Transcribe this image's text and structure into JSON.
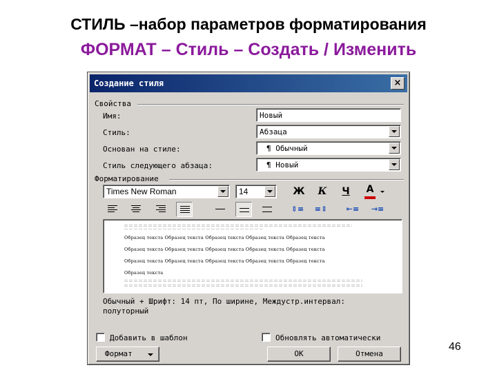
{
  "slide": {
    "title": "СТИЛЬ –набор параметров форматирования",
    "subtitle": "ФОРМАТ – Стиль – Создать / Изменить",
    "page_number": "46"
  },
  "dialog": {
    "title": "Создание стиля",
    "close_label": "×",
    "properties_group": "Свойства",
    "name_label": "Имя:",
    "name_value": "Новый",
    "style_label": "Стиль:",
    "style_value": "Абзаца",
    "based_on_label": "Основан на стиле:",
    "based_on_value": "¶ Обычный",
    "next_style_label": "Стиль следующего абзаца:",
    "next_style_value": "¶ Новый",
    "formatting_group": "Форматирование",
    "font_name": "Times New Roman",
    "font_size": "14",
    "bold_label": "Ж",
    "italic_label": "К",
    "underline_label": "Ч",
    "font_color_label": "А",
    "font_color": "#cc0000",
    "preview_sample_text": "Образец текста Образец текста Образец текста Образец текста Образец текста",
    "preview_last_line": "Образец текста",
    "description_line1": "Обычный + Шрифт: 14 пт, По ширине, Междустр.интервал:",
    "description_line2": "полуторный",
    "add_to_template_label": "Добавить в шаблон",
    "auto_update_label": "Обновлять автоматически",
    "format_button": "Формат",
    "ok_button": "OK",
    "cancel_button": "Отмена"
  }
}
